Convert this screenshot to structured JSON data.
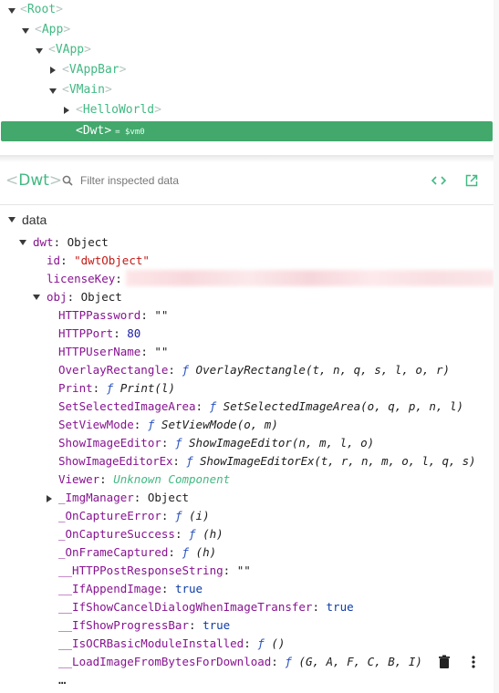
{
  "tree": {
    "nodes": [
      {
        "label": "Root",
        "expanded": true
      },
      {
        "label": "App",
        "expanded": true
      },
      {
        "label": "VApp",
        "expanded": true
      },
      {
        "label": "VAppBar",
        "expanded": false
      },
      {
        "label": "VMain",
        "expanded": true
      },
      {
        "label": "HelloWorld",
        "expanded": false
      }
    ],
    "selected": {
      "label": "Dwt",
      "vm": "= $vm0"
    }
  },
  "inspector": {
    "component_name": "Dwt",
    "filter_placeholder": "Filter inspected data"
  },
  "data": {
    "section_label": "data",
    "rows": [
      {
        "key": "dwt",
        "sep": ": ",
        "value": "Object",
        "type": "obj"
      },
      {
        "key": "id",
        "sep": ": ",
        "value": "\"dwtObject\"",
        "type": "str"
      },
      {
        "key": "licenseKey",
        "sep": ":",
        "value": "",
        "type": "redacted"
      },
      {
        "key": "obj",
        "sep": ": ",
        "value": "Object",
        "type": "obj"
      },
      {
        "key": "HTTPPassword",
        "sep": ": ",
        "value": "\"\"",
        "type": "plain"
      },
      {
        "key": "HTTPPort",
        "sep": ": ",
        "value": "80",
        "type": "num"
      },
      {
        "key": "HTTPUserName",
        "sep": ": ",
        "value": "\"\"",
        "type": "plain"
      },
      {
        "key": "OverlayRectangle",
        "sep": ": ",
        "f": "ƒ",
        "value": "OverlayRectangle(t, n, q, s, l, o, r)",
        "type": "fn"
      },
      {
        "key": "Print",
        "sep": ": ",
        "f": "ƒ",
        "value": "Print(l)",
        "type": "fn"
      },
      {
        "key": "SetSelectedImageArea",
        "sep": ": ",
        "f": "ƒ",
        "value": "SetSelectedImageArea(o, q, p, n, l)",
        "type": "fn"
      },
      {
        "key": "SetViewMode",
        "sep": ": ",
        "f": "ƒ",
        "value": "SetViewMode(o, m)",
        "type": "fn"
      },
      {
        "key": "ShowImageEditor",
        "sep": ": ",
        "f": "ƒ",
        "value": "ShowImageEditor(n, m, l, o)",
        "type": "fn"
      },
      {
        "key": "ShowImageEditorEx",
        "sep": ": ",
        "f": "ƒ",
        "value": "ShowImageEditorEx(t, r, n, m, o, l, q, s)",
        "type": "fn"
      },
      {
        "key": "Viewer",
        "sep": ": ",
        "value": "Unknown Component",
        "type": "comp"
      },
      {
        "key": "_ImgManager",
        "sep": ": ",
        "value": "Object",
        "type": "obj"
      },
      {
        "key": "_OnCaptureError",
        "sep": ": ",
        "f": "ƒ",
        "value": "(i)",
        "type": "fn"
      },
      {
        "key": "_OnCaptureSuccess",
        "sep": ": ",
        "f": "ƒ",
        "value": "(h)",
        "type": "fn"
      },
      {
        "key": "_OnFrameCaptured",
        "sep": ": ",
        "f": "ƒ",
        "value": "(h)",
        "type": "fn"
      },
      {
        "key": "__HTTPPostResponseString",
        "sep": ": ",
        "value": "\"\"",
        "type": "plain"
      },
      {
        "key": "__IfAppendImage",
        "sep": ": ",
        "value": "true",
        "type": "bool"
      },
      {
        "key": "__IfShowCancelDialogWhenImageTransfer",
        "sep": ": ",
        "value": "true",
        "type": "bool"
      },
      {
        "key": "__IfShowProgressBar",
        "sep": ": ",
        "value": "true",
        "type": "bool"
      },
      {
        "key": "__IsOCRBasicModuleInstalled",
        "sep": ": ",
        "f": "ƒ",
        "value": "()",
        "type": "fn"
      },
      {
        "key": "__LoadImageFromBytesForDownload",
        "sep": ": ",
        "f": "ƒ",
        "value": "(G, A, F, C, B, I)",
        "type": "fn"
      }
    ],
    "ellipsis": "…"
  },
  "icons": {
    "search": "search-icon",
    "code": "code-icon",
    "open": "open-in-new-icon",
    "trash": "trash-icon",
    "more": "more-vert-icon"
  },
  "colors": {
    "accent": "#42b983",
    "selected_bg": "#42a86c",
    "key": "#881391",
    "string": "#c41a16",
    "number": "#1a1aa6"
  }
}
